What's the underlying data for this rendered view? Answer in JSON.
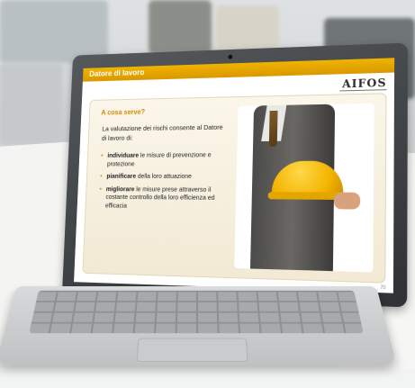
{
  "slide": {
    "title": "Datore di lavoro",
    "logo": "AIFOS",
    "section_heading": "A cosa serve?",
    "intro": "La valutazione dei rischi consente al Datore di lavoro di:",
    "bullets": [
      {
        "bold": "individuare",
        "rest": " le misure di prevenzione e protezione"
      },
      {
        "bold": "pianificare",
        "rest": " della loro attuazione"
      },
      {
        "bold": "migliorare",
        "rest": " le misure prese attraverso il costante controllo della loro efficienza ed efficacia"
      }
    ],
    "slide_number": "70"
  }
}
